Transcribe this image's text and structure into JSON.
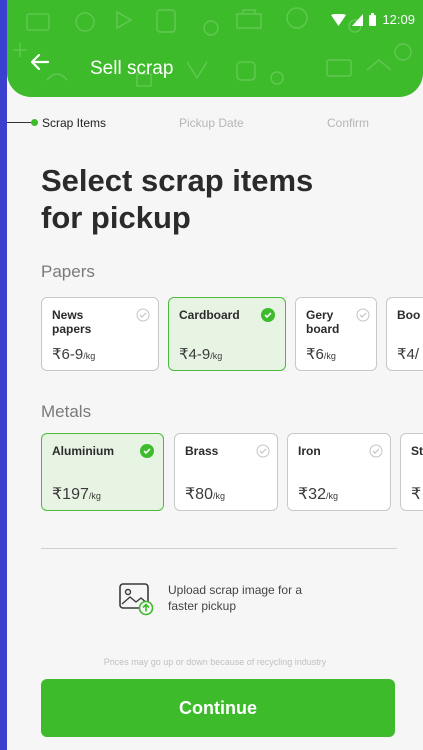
{
  "status_bar": {
    "time": "12:09"
  },
  "header": {
    "title": "Sell scrap"
  },
  "steps": [
    "Scrap Items",
    "Pickup Date",
    "Confirm"
  ],
  "heading": "Select scrap items for pickup",
  "papers": {
    "label": "Papers",
    "items": [
      {
        "name": "News papers",
        "price": "₹6-9",
        "unit": "/kg",
        "selected": false
      },
      {
        "name": "Cardboard",
        "price": "₹4-9",
        "unit": "/kg",
        "selected": true
      },
      {
        "name": "Gery board",
        "price": "₹6",
        "unit": "/kg",
        "selected": false
      },
      {
        "name": "Boo",
        "price": "₹4/",
        "unit": "",
        "selected": false
      }
    ]
  },
  "metals": {
    "label": "Metals",
    "items": [
      {
        "name": "Aluminium",
        "price": "₹197",
        "unit": "/kg",
        "selected": true
      },
      {
        "name": "Brass",
        "price": "₹80",
        "unit": "/kg",
        "selected": false
      },
      {
        "name": "Iron",
        "price": "₹32",
        "unit": "/kg",
        "selected": false
      },
      {
        "name": "St",
        "price": "₹",
        "unit": "",
        "selected": false
      }
    ]
  },
  "upload": {
    "text": "Upload scrap image for a faster pickup"
  },
  "note": "Prices may go up or down because of recycling industry",
  "continue_label": "Continue",
  "colors": {
    "accent": "#3dbb2b",
    "selected_bg": "#e8f4e3",
    "frame": "#3b3fd0"
  }
}
